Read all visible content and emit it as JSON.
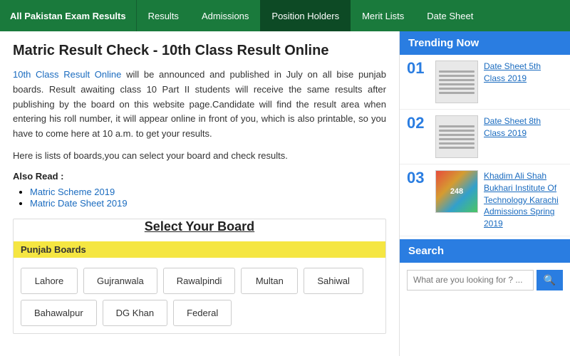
{
  "nav": {
    "brand": "All Pakistan Exam Results",
    "items": [
      {
        "label": "Results",
        "active": false
      },
      {
        "label": "Admissions",
        "active": false
      },
      {
        "label": "Position Holders",
        "active": true
      },
      {
        "label": "Merit Lists",
        "active": false
      },
      {
        "label": "Date Sheet",
        "active": false
      }
    ]
  },
  "content": {
    "title": "Matric Result Check - 10th Class Result Online",
    "paragraph": "10th Class Result Online will be announced and published in July on all bise punjab boards. Result awaiting class 10 Part II students will receive the same results after publishing by the board on this website page.Candidate will find the result area when entering his roll number, it will appear online in front of you, which is also printable, so you have to come here at 10 a.m. to get your results.",
    "boards_text": "Here is lists of boards,you can select your board and check results.",
    "also_read_label": "Also Read :",
    "links": [
      {
        "label": "Matric Scheme 2019"
      },
      {
        "label": "Matric Date Sheet 2019"
      }
    ],
    "board_section_title": "Select Your Board",
    "group_label": "Punjab Boards",
    "boards": [
      "Lahore",
      "Gujranwala",
      "Rawalpindi",
      "Multan",
      "Sahiwal",
      "Bahawalpur",
      "DG Khan",
      "Federal"
    ]
  },
  "sidebar": {
    "trending_title": "Trending Now",
    "trending_items": [
      {
        "num": "01",
        "title": "Date Sheet 5th Class 2019"
      },
      {
        "num": "02",
        "title": "Date Sheet 8th Class 2019"
      },
      {
        "num": "03",
        "title": "Khadim Ali Shah Bukhari Institute Of Technology Karachi Admissions Spring 2019"
      }
    ],
    "search_title": "Search",
    "search_placeholder": "What are you looking for ? ..."
  }
}
